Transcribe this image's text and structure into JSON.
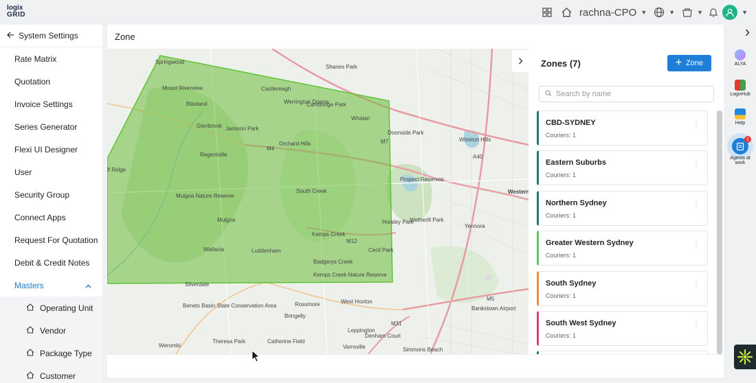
{
  "logo": {
    "line1": "logix",
    "line2": "GRID"
  },
  "header": {
    "user_name": "rachna-CPO"
  },
  "sidebar": {
    "back_label": "System Settings",
    "items": [
      {
        "label": "Rate Matrix"
      },
      {
        "label": "Quotation"
      },
      {
        "label": "Invoice Settings"
      },
      {
        "label": "Series Generator"
      },
      {
        "label": "Flexi UI Designer"
      },
      {
        "label": "User"
      },
      {
        "label": "Security Group"
      },
      {
        "label": "Connect Apps"
      },
      {
        "label": "Request For Quotation"
      },
      {
        "label": "Debit & Credit Notes"
      }
    ],
    "masters_label": "Masters",
    "masters_children": [
      {
        "label": "Operating Unit"
      },
      {
        "label": "Vendor"
      },
      {
        "label": "Package Type"
      },
      {
        "label": "Customer"
      }
    ]
  },
  "main": {
    "title": "Zone"
  },
  "map": {
    "labels": [
      "Springwood",
      "Mount Riverview",
      "Castlereagh",
      "Shanes Park",
      "Blaxland",
      "Werrington Downs",
      "Glenbrook",
      "Jamison Park",
      "Cambridge Park",
      "Whalan",
      "Doonside Park",
      "Orchard Hills",
      "Winston Hills",
      "Regentville",
      "Propect Reservoir",
      "South Creek",
      "Mulgoa",
      "Kemps Creek",
      "Wetherill Park",
      "Yennora",
      "Wallacia",
      "Luddenham",
      "Cecil Park",
      "Badgerys Creek",
      "Silverdale",
      "Rossmore",
      "West Hoxton",
      "Bankstown Airport",
      "Bringelly",
      "Leppington",
      "Werombi",
      "Theresa Park",
      "Catherine Field",
      "Denham Court",
      "Varroville",
      "Simmons Beach",
      "lf Ridge",
      "Western",
      "Horsley Park",
      "Kemps Creek Nature Reserve",
      "Mulgoa Nature Reserve",
      "Benets Basin State Conservation Area",
      "M4",
      "M7",
      "M12",
      "M5",
      "M31",
      "A40"
    ]
  },
  "zones": {
    "title": "Zones (7)",
    "add_label": "Zone",
    "search_placeholder": "Search by name",
    "items": [
      {
        "name": "CBD-SYDNEY",
        "sub": "Couriers: 1",
        "color": "#1a7a6e"
      },
      {
        "name": "Eastern Suburbs",
        "sub": "Couriers: 1",
        "color": "#1a7a6e"
      },
      {
        "name": "Northern Sydney",
        "sub": "Couriers: 1",
        "color": "#1a7a6e"
      },
      {
        "name": "Greater Western Sydney",
        "sub": "Couriers: 1",
        "color": "#5cc85c"
      },
      {
        "name": "South Sydney",
        "sub": "Couriers: 1",
        "color": "#f08a3c"
      },
      {
        "name": "South West Sydney",
        "sub": "Couriers: 1",
        "color": "#e3387b"
      },
      {
        "name": "",
        "sub": "",
        "color": "#1a7a6e"
      }
    ]
  },
  "rail": {
    "alya": "ALYA",
    "logixhub": "LogixHub",
    "help": "Help",
    "agents": "Agents at work",
    "agents_badge": "1"
  }
}
